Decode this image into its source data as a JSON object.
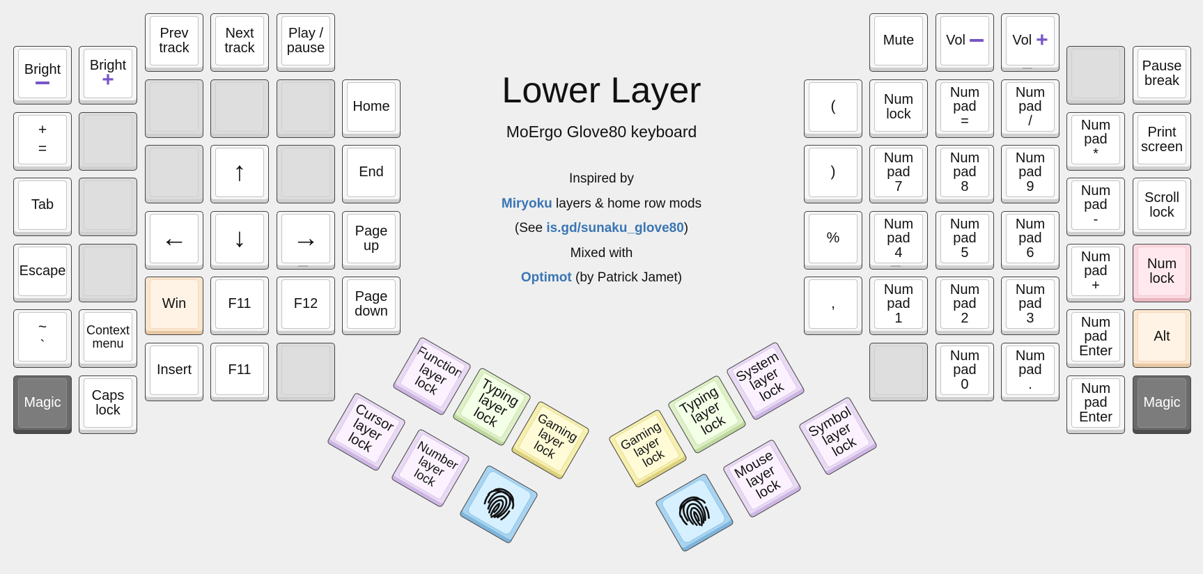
{
  "title": "Lower Layer",
  "subtitle": "MoErgo Glove80 keyboard",
  "credits": {
    "inspired": "Inspired by",
    "miryoku": "Miryoku",
    "miryoku_rest": " layers & home row mods",
    "see_open": "(See ",
    "see_link": "is.gd/sunaku_glove80",
    "see_close": ")",
    "mixed": "Mixed with",
    "optimot": "Optimot",
    "optimot_rest": " (by Patrick Jamet)"
  },
  "colors": {
    "accent_purple": "#7856c9",
    "link_blue": "#3a76b4",
    "magic_gray": "#6a6a6a",
    "win_orange": "#fff3e6",
    "numlock_red": "#ffe9ee",
    "layer_purple": "#fcf2ff",
    "layer_green": "#f3ffe6",
    "layer_yellow": "#fffbd6",
    "fingerprint_blue": "#d6f0ff"
  },
  "keys": {
    "bright_minus": {
      "lines": [
        "Bright"
      ],
      "icon": "minus-icon"
    },
    "bright_plus": {
      "lines": [
        "Bright"
      ],
      "icon": "plus-icon"
    },
    "plus_equal": {
      "lines": [
        "+",
        "="
      ]
    },
    "tab": {
      "lines": [
        "Tab"
      ]
    },
    "escape": {
      "lines": [
        "Escape"
      ]
    },
    "tilde": {
      "lines": [
        "~",
        "`"
      ]
    },
    "context_menu": {
      "lines": [
        "Context",
        "menu"
      ]
    },
    "magic_left": {
      "lines": [
        "Magic"
      ]
    },
    "caps_lock": {
      "lines": [
        "Caps",
        "lock"
      ]
    },
    "prev_track": {
      "lines": [
        "Prev",
        "track"
      ]
    },
    "next_track": {
      "lines": [
        "Next",
        "track"
      ]
    },
    "play_pause": {
      "lines": [
        "Play /",
        "pause"
      ]
    },
    "arrow_up": {
      "lines": [
        "↑"
      ]
    },
    "arrow_left": {
      "lines": [
        "←"
      ]
    },
    "arrow_down": {
      "lines": [
        "↓"
      ]
    },
    "arrow_right": {
      "lines": [
        "→"
      ]
    },
    "home": {
      "lines": [
        "Home"
      ]
    },
    "end": {
      "lines": [
        "End"
      ]
    },
    "page_up": {
      "lines": [
        "Page",
        "up"
      ]
    },
    "page_down": {
      "lines": [
        "Page",
        "down"
      ]
    },
    "win": {
      "lines": [
        "Win"
      ]
    },
    "f11_a": {
      "lines": [
        "F11"
      ]
    },
    "f12": {
      "lines": [
        "F12"
      ]
    },
    "insert": {
      "lines": [
        "Insert"
      ]
    },
    "f11_b": {
      "lines": [
        "F11"
      ]
    },
    "mute": {
      "lines": [
        "Mute"
      ]
    },
    "vol_minus": {
      "lines": [
        "Vol"
      ],
      "icon": "minus-icon"
    },
    "vol_plus": {
      "lines": [
        "Vol"
      ],
      "icon": "plus-icon"
    },
    "paren_open": {
      "lines": [
        "("
      ]
    },
    "paren_close": {
      "lines": [
        ")"
      ]
    },
    "percent": {
      "lines": [
        "%"
      ]
    },
    "comma": {
      "lines": [
        ","
      ]
    },
    "num_lock_a": {
      "lines": [
        "Num",
        "lock"
      ]
    },
    "np_equal": {
      "lines": [
        "Num",
        "pad",
        "="
      ]
    },
    "np_slash": {
      "lines": [
        "Num",
        "pad",
        "/"
      ]
    },
    "np_7": {
      "lines": [
        "Num",
        "pad",
        "7"
      ]
    },
    "np_8": {
      "lines": [
        "Num",
        "pad",
        "8"
      ]
    },
    "np_9": {
      "lines": [
        "Num",
        "pad",
        "9"
      ]
    },
    "np_4": {
      "lines": [
        "Num",
        "pad",
        "4"
      ]
    },
    "np_5": {
      "lines": [
        "Num",
        "pad",
        "5"
      ]
    },
    "np_6": {
      "lines": [
        "Num",
        "pad",
        "6"
      ]
    },
    "np_1": {
      "lines": [
        "Num",
        "pad",
        "1"
      ]
    },
    "np_2": {
      "lines": [
        "Num",
        "pad",
        "2"
      ]
    },
    "np_3": {
      "lines": [
        "Num",
        "pad",
        "3"
      ]
    },
    "np_0": {
      "lines": [
        "Num",
        "pad",
        "0"
      ]
    },
    "np_dot": {
      "lines": [
        "Num",
        "pad",
        "."
      ]
    },
    "np_star": {
      "lines": [
        "Num",
        "pad",
        "*"
      ]
    },
    "np_minus": {
      "lines": [
        "Num",
        "pad",
        "-"
      ]
    },
    "np_plus": {
      "lines": [
        "Num",
        "pad",
        "+"
      ]
    },
    "np_enter_a": {
      "lines": [
        "Num",
        "pad",
        "Enter"
      ]
    },
    "np_enter_b": {
      "lines": [
        "Num",
        "pad",
        "Enter"
      ]
    },
    "pause_break": {
      "lines": [
        "Pause",
        "break"
      ]
    },
    "print_screen": {
      "lines": [
        "Print",
        "screen"
      ]
    },
    "scroll_lock": {
      "lines": [
        "Scroll",
        "lock"
      ]
    },
    "num_lock_b": {
      "lines": [
        "Num",
        "lock"
      ]
    },
    "alt": {
      "lines": [
        "Alt"
      ]
    },
    "magic_right": {
      "lines": [
        "Magic"
      ]
    },
    "function_layer": {
      "lines": [
        "Function",
        "layer",
        "lock"
      ]
    },
    "typing_layer_l": {
      "lines": [
        "Typing",
        "layer",
        "lock"
      ]
    },
    "gaming_layer_l": {
      "lines": [
        "Gaming",
        "layer",
        "lock"
      ]
    },
    "cursor_layer": {
      "lines": [
        "Cursor",
        "layer",
        "lock"
      ]
    },
    "number_layer": {
      "lines": [
        "Number",
        "layer",
        "lock"
      ]
    },
    "fingerprint_l": {
      "icon": "fingerprint-icon"
    },
    "gaming_layer_r": {
      "lines": [
        "Gaming",
        "layer",
        "lock"
      ]
    },
    "typing_layer_r": {
      "lines": [
        "Typing",
        "layer",
        "lock"
      ]
    },
    "system_layer": {
      "lines": [
        "System",
        "layer",
        "lock"
      ]
    },
    "mouse_layer": {
      "lines": [
        "Mouse",
        "layer",
        "lock"
      ]
    },
    "symbol_layer": {
      "lines": [
        "Symbol",
        "layer",
        "lock"
      ]
    },
    "fingerprint_r": {
      "icon": "fingerprint-icon"
    }
  }
}
